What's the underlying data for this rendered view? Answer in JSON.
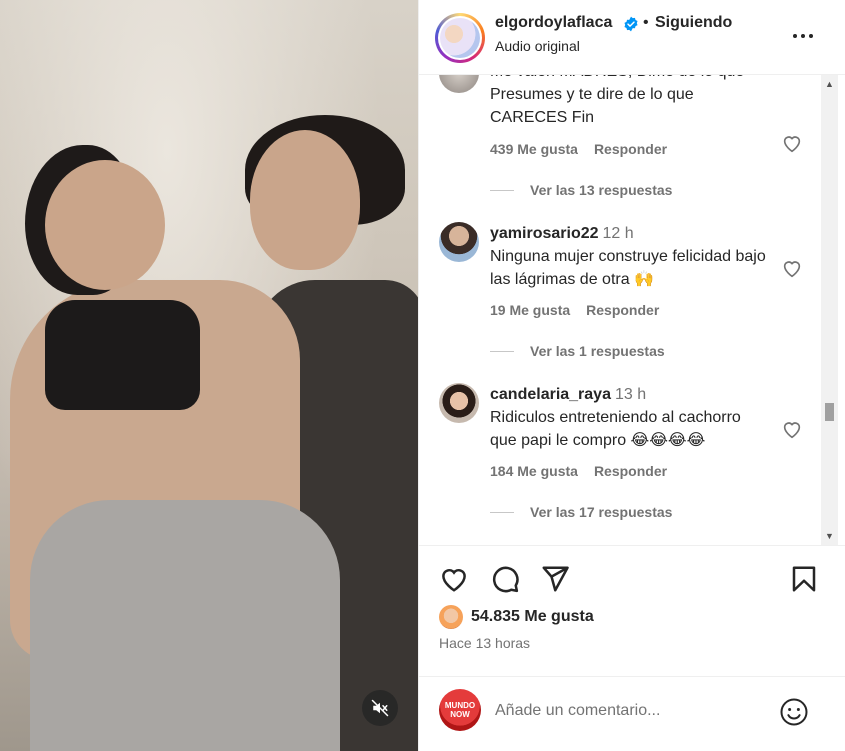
{
  "post": {
    "username": "elgordoylaflaca",
    "separator": "•",
    "follow_status": "Siguiendo",
    "audio": "Audio original",
    "likes": "54.835 Me gusta",
    "time_ago": "Hace 13 horas"
  },
  "comments": [
    {
      "text_line1": "Me valen MADRES, Dime de lo que",
      "text_line2": "Presumes y te dire de lo que",
      "text_line3": "CARECES Fin",
      "likes": "439 Me gusta",
      "reply": "Responder",
      "replies": "Ver las 13 respuestas"
    },
    {
      "username": "yamirosario22",
      "time": "12 h",
      "text": "Ninguna mujer construye felicidad bajo las lágrimas de otra 🙌",
      "likes": "19 Me gusta",
      "reply": "Responder",
      "replies": "Ver las 1 respuestas"
    },
    {
      "username": "candelaria_raya",
      "time": "13 h",
      "text": "Ridiculos entreteniendo al cachorro que papi le compro 😂😂😂😂",
      "likes": "184 Me gusta",
      "reply": "Responder",
      "replies": "Ver las 17 respuestas"
    }
  ],
  "composer": {
    "placeholder": "Añade un comentario...",
    "avatar_text": "MUNDO NOW"
  },
  "icons": {
    "verified": "verified-badge-icon",
    "more": "more-options-icon",
    "like": "heart-icon",
    "comment": "comment-bubble-icon",
    "share": "paper-plane-icon",
    "save": "bookmark-icon",
    "emoji": "emoji-icon",
    "mute": "muted-speaker-icon"
  },
  "colors": {
    "verified_blue": "#0095f6",
    "text_primary": "#262626",
    "text_secondary": "#737373"
  }
}
